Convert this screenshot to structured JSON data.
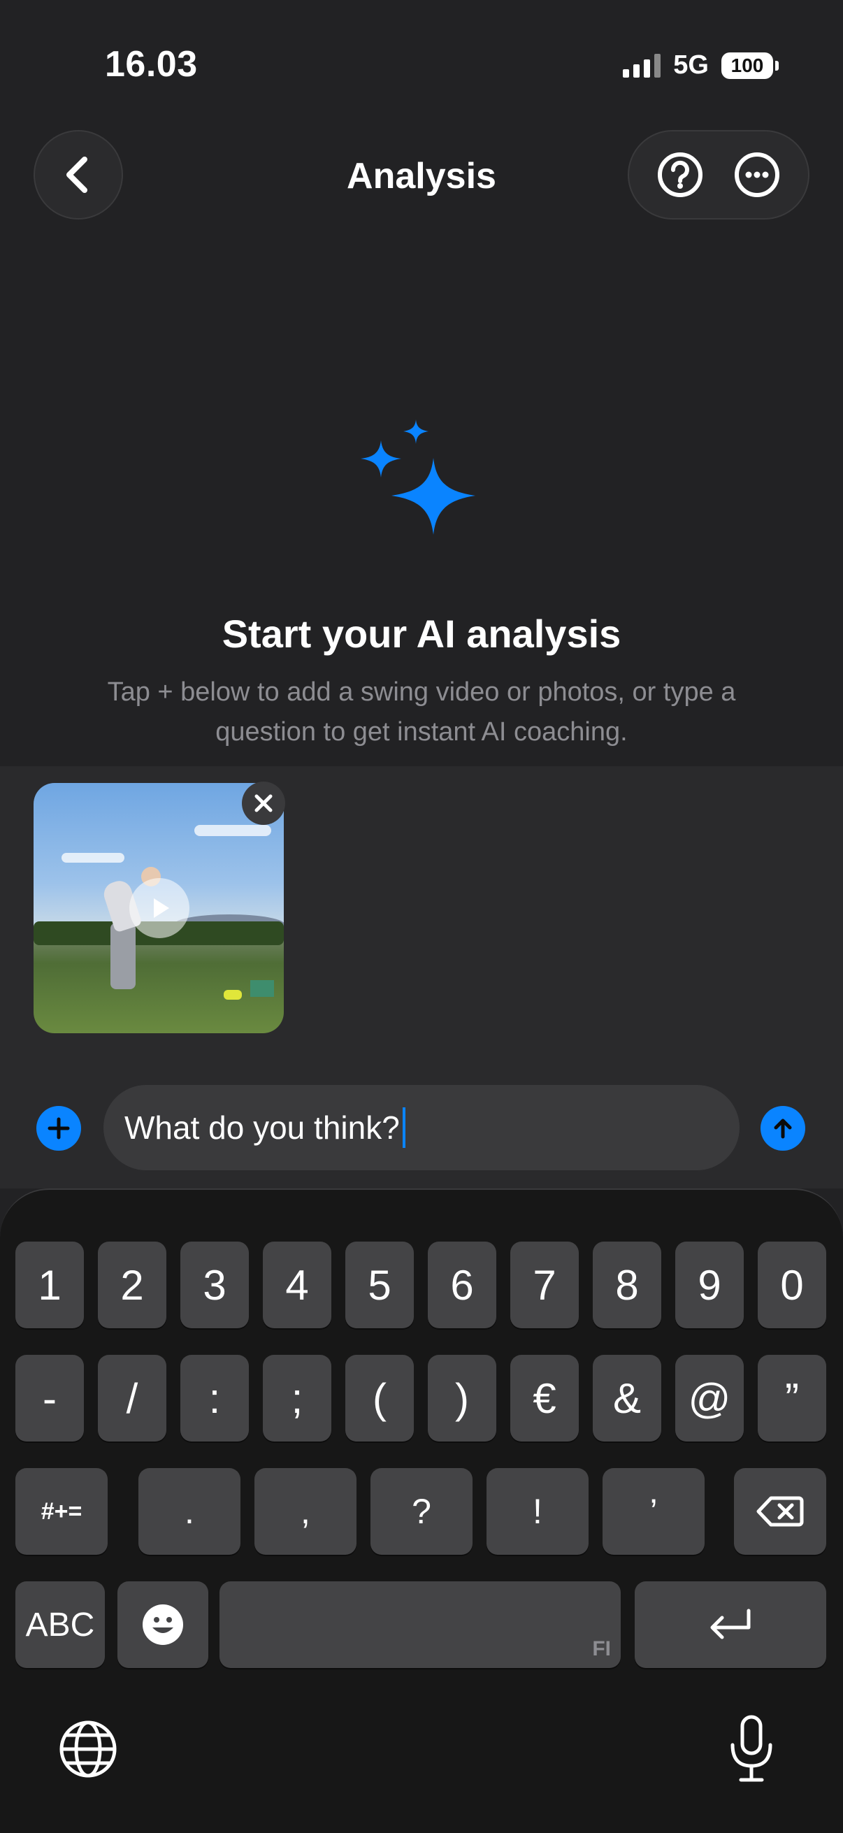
{
  "status": {
    "time": "16.03",
    "network": "5G",
    "battery": "100"
  },
  "header": {
    "title": "Analysis"
  },
  "empty_state": {
    "title": "Start your AI analysis",
    "subtitle": "Tap + below to add a swing video or photos, or type a question to get instant AI coaching."
  },
  "composer": {
    "text": "What do you think?"
  },
  "keyboard": {
    "row1": [
      "1",
      "2",
      "3",
      "4",
      "5",
      "6",
      "7",
      "8",
      "9",
      "0"
    ],
    "row2": [
      "-",
      "/",
      ":",
      ";",
      "(",
      ")",
      "€",
      "&",
      "@",
      "”"
    ],
    "row3": [
      ".",
      ",",
      "?",
      "!",
      "’"
    ],
    "shift_label": "#+=",
    "abc_label": "ABC",
    "space_hint": "FI"
  },
  "colors": {
    "accent": "#0a84ff",
    "background": "#222224",
    "key": "#444446"
  }
}
